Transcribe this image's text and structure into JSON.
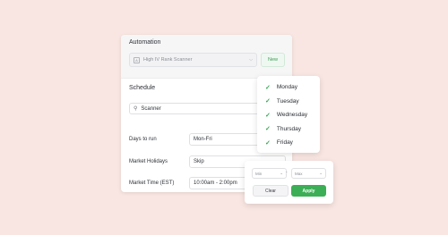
{
  "automation": {
    "title": "Automation",
    "selected_app": "High IV Rank Scanner",
    "app_icon": "A",
    "new_label": "New"
  },
  "schedule": {
    "title": "Schedule",
    "search_value": "Scanner",
    "rows": [
      {
        "label": "Days to run",
        "value": "Mon-Fri"
      },
      {
        "label": "Market Holidays",
        "value": "Skip"
      },
      {
        "label": "Market Time (EST)",
        "value": "10:00am - 2:00pm"
      }
    ]
  },
  "days_popover": {
    "days": [
      {
        "label": "Monday",
        "checked": true
      },
      {
        "label": "Tuesday",
        "checked": true
      },
      {
        "label": "Wednesday",
        "checked": true
      },
      {
        "label": "Thursday",
        "checked": true
      },
      {
        "label": "Friday",
        "checked": true
      }
    ]
  },
  "time_popover": {
    "min_placeholder": "Min",
    "max_placeholder": "Max",
    "separator": "-",
    "clear_label": "Clear",
    "apply_label": "Apply"
  },
  "colors": {
    "background": "#f9e6e2",
    "accent_green": "#3cae56"
  }
}
